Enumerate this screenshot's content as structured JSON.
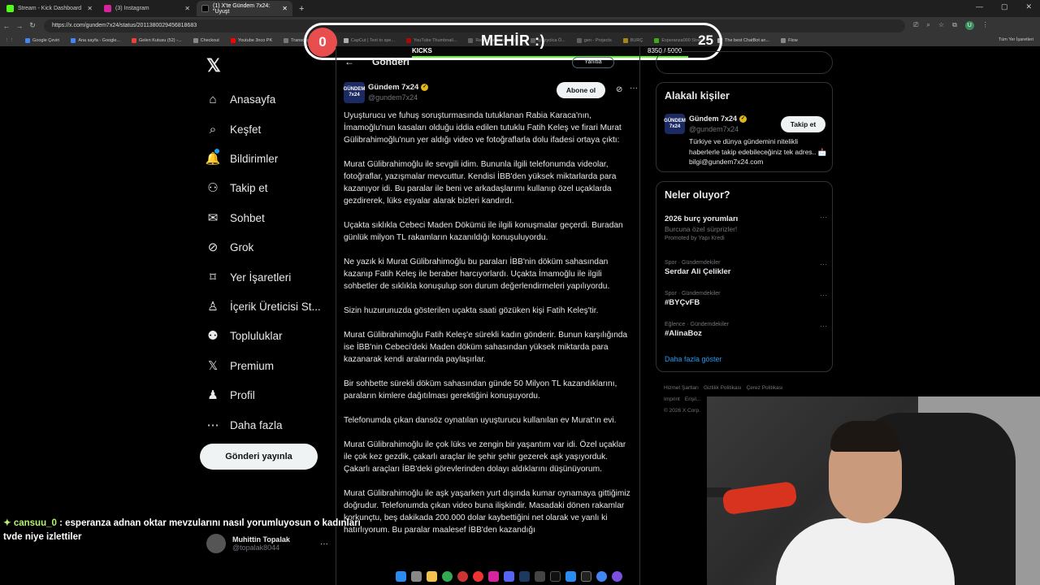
{
  "browser": {
    "tabs": [
      {
        "label": "Stream - Kick Dashboard",
        "color": "#53fc18"
      },
      {
        "label": "(3) Instagram",
        "color": "#d6249f"
      },
      {
        "label": "(1) X'te Gündem 7x24: \"Uyuşt",
        "color": "#000000"
      }
    ],
    "new_tab": "+",
    "url": "https://x.com/gundem7x24/status/2011380029456818683",
    "bookmarks": [
      "Google Çeviri",
      "Ana sayfa - Google...",
      "Gelen Kutusu (52) -...",
      "Checkout",
      "Youtube 3nco PK",
      "Transcript of \"MI M...",
      "CapCut | Text to spe...",
      "YouTube Thumbnail...",
      "Resize and reduce i...",
      "İşsizyolca Ö...",
      "gen - Projects",
      "BURÇ",
      "Esperanza000 Strea...",
      "The best ChatBot an...",
      "Flow"
    ],
    "bookmarks_right": "Tüm Yer İşaretleri",
    "profile_initial": "U"
  },
  "overlay": {
    "left_value": "0",
    "title": "MEHİR :)",
    "right_value": "25",
    "kicks_label": "KICKS",
    "kicks_count": "8350 / 5000",
    "progress": 1.0
  },
  "nav": {
    "items": [
      {
        "label": "Anasayfa",
        "icon": "home-icon",
        "glyph": "⌂"
      },
      {
        "label": "Keşfet",
        "icon": "search-icon",
        "glyph": "⌕"
      },
      {
        "label": "Bildirimler",
        "icon": "bell-icon",
        "glyph": "🔔"
      },
      {
        "label": "Takip et",
        "icon": "person-add-icon",
        "glyph": "⚇"
      },
      {
        "label": "Sohbet",
        "icon": "mail-icon",
        "glyph": "✉"
      },
      {
        "label": "Grok",
        "icon": "grok-icon",
        "glyph": "⊘"
      },
      {
        "label": "Yer İşaretleri",
        "icon": "bookmark-icon",
        "glyph": "⌑"
      },
      {
        "label": "İçerik Üreticisi St...",
        "icon": "creator-icon",
        "glyph": "♙"
      },
      {
        "label": "Topluluklar",
        "icon": "communities-icon",
        "glyph": "⚉"
      },
      {
        "label": "Premium",
        "icon": "x-premium-icon",
        "glyph": "𝕏"
      },
      {
        "label": "Profil",
        "icon": "profile-icon",
        "glyph": "♟"
      },
      {
        "label": "Daha fazla",
        "icon": "more-circle-icon",
        "glyph": "⋯"
      }
    ],
    "post_button": "Gönderi yayınla",
    "account": {
      "name": "Muhittin Topalak",
      "handle": "@topalak8044"
    }
  },
  "main": {
    "header_title": "Gönderi",
    "header_reply": "Yanıtla",
    "author": {
      "name": "Gündem 7x24",
      "handle": "@gundem7x24",
      "avatar_text": "GÜNDEM 7x24"
    },
    "subscribe": "Abone ol",
    "tweet_paragraphs": [
      "Uyuşturucu ve fuhuş soruşturmasında tutuklanan Rabia Karaca'nın, İmamoğlu'nun kasaları olduğu iddia edilen tutuklu Fatih Keleş ve firari Murat Gülibrahimoğlu'nun yer aldığı video ve fotoğraflarla dolu ifadesi ortaya çıktı:",
      "Murat Gülibrahimoğlu ile  sevgili idim. Bununla ilgili telefonumda videolar, fotoğraflar, yazışmalar mevcuttur.  Kendisi İBB'den yüksek miktarlarda para kazanıyor idi. Bu paralar ile beni ve arkadaşlarımı kullanıp özel uçaklarda gezdirerek, lüks eşyalar alarak bizleri kandırdı.",
      "Uçakta sıklıkla Cebeci Maden Dökümü ile ilgili konuşmalar geçerdi. Buradan günlük milyon TL rakamların kazanıldığı konuşuluyordu.",
      "Ne yazık ki Murat Gülibrahimoğlu bu paraları İBB'nin döküm sahasından kazanıp Fatih Keleş ile beraber harcıyorlardı. Uçakta İmamoğlu ile ilgili sohbetler de sıklıkla konuşulup son durum değerlendirmeleri yapılıyordu.",
      "Sizin huzurunuzda gösterilen uçakta saati gözüken kişi Fatih Keleş'tir.",
      "Murat Gülibrahimoğlu Fatih Keleş'e sürekli kadın gönderir. Bunun karşılığında ise İBB'nin Cebeci'deki Maden döküm sahasından yüksek miktarda para kazanarak kendi aralarında paylaşırlar.",
      "Bir sohbette sürekli döküm sahasından günde 50 Milyon TL kazandıklarını, paraların kimlere dağıtılması gerektiğini konuşuyordu.",
      "Telefonumda çıkan dansöz oynatılan uyuşturucu kullanılan ev Murat'ın evi.",
      "Murat Gülibrahimoğlu ile çok lüks ve zengin bir yaşantım var idi. Özel uçaklar ile çok kez gezdik, çakarlı araçlar ile şehir şehir gezerek aşk yaşıyorduk. Çakarlı araçları İBB'deki görevlerinden dolayı aldıklarını düşünüyorum.",
      "Murat Gülibrahimoğlu ile aşk yaşarken yurt dışında kumar oynamaya gittiğimiz doğrudur. Telefonumda çıkan video buna ilişkindir. Masadaki dönen rakamlar korkunçtu, beş dakikada 200.000 dolar kaybettiğini net olarak ve yanlı ki hatırlıyorum. Bu paralar maalesef İBB'den kazandığı"
    ]
  },
  "right": {
    "related_title": "Alakalı kişiler",
    "related": {
      "name": "Gündem 7x24",
      "handle": "@gundem7x24",
      "follow": "Takip et",
      "bio": "Türkiye ve dünya gündemini nitelikli haberlerle takip edebileceğiniz tek adres.. 📩bilgi@gundem7x24.com"
    },
    "trends_title": "Neler oluyor?",
    "trends": [
      {
        "category": "",
        "title": "2026 burç yorumları",
        "desc": "Burcuna özel sürprizler!",
        "promo": "Promoted by Yapı Kredi"
      },
      {
        "category": "Spor · Gündemdekiler",
        "title": "Serdar Ali Çelikler",
        "desc": "",
        "promo": ""
      },
      {
        "category": "Spor · Gündemdekiler",
        "title": "#BYÇvFB",
        "desc": "",
        "promo": ""
      },
      {
        "category": "Eğlence · Gündemdekiler",
        "title": "#AlinaBoz",
        "desc": "",
        "promo": ""
      }
    ],
    "show_more": "Daha fazla göster",
    "footer": [
      "Hizmet Şartları",
      "Gizlilik Politikası",
      "Çerez Politikası",
      "Imprint",
      "Erişil...",
      "© 2026 X Corp."
    ]
  },
  "chat": {
    "user": "cansuu_0",
    "line1": " : esperanza adnan oktar mevzularını nasıl yorumluyosun o kadınları",
    "line2": "tvde niye izlettiler"
  },
  "colors": {
    "accent": "#1d9bf0",
    "kick_green": "#53fc18",
    "overlay_red": "#e94e4e"
  }
}
